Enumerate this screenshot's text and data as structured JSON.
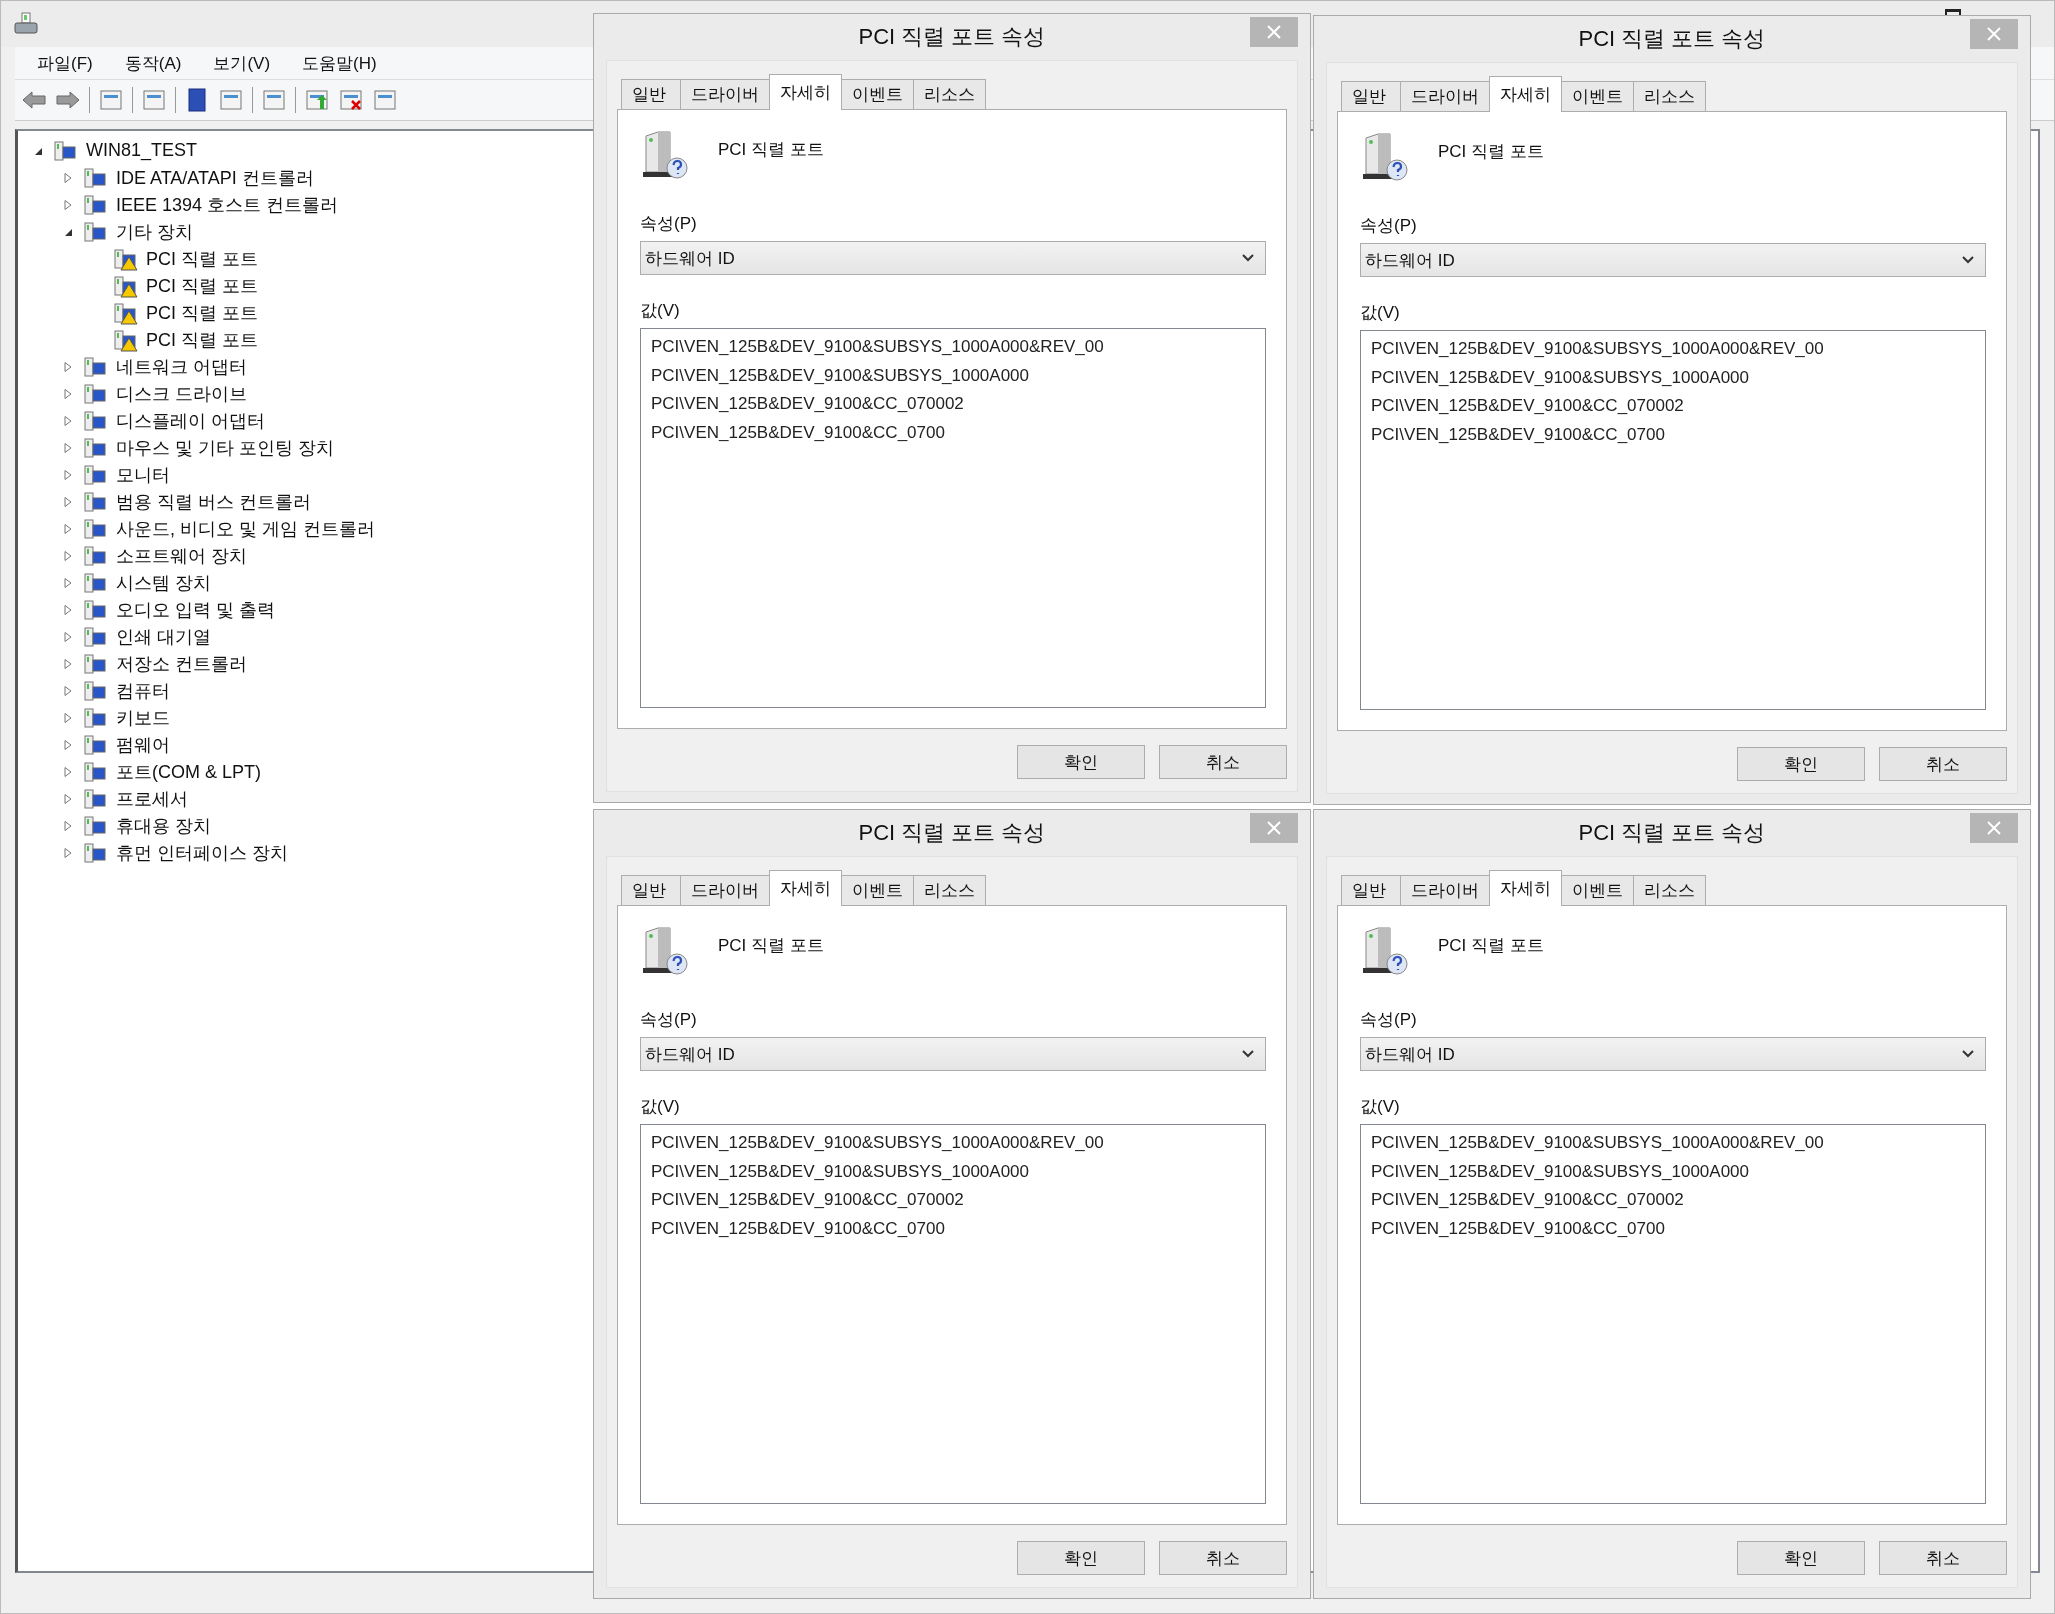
{
  "main_window": {
    "menu": [
      "파일(F)",
      "동작(A)",
      "보기(V)",
      "도움말(H)"
    ],
    "tree": {
      "label": "WIN81_TEST",
      "expanded": true,
      "children": [
        {
          "label": "IDE ATA/ATAPI 컨트롤러",
          "expanded": false
        },
        {
          "label": "IEEE 1394 호스트 컨트롤러",
          "expanded": false
        },
        {
          "label": "기타 장치",
          "expanded": true,
          "children": [
            {
              "label": "PCI 직렬 포트",
              "warning": true
            },
            {
              "label": "PCI 직렬 포트",
              "warning": true
            },
            {
              "label": "PCI 직렬 포트",
              "warning": true
            },
            {
              "label": "PCI 직렬 포트",
              "warning": true
            }
          ]
        },
        {
          "label": "네트워크 어댑터",
          "expanded": false
        },
        {
          "label": "디스크 드라이브",
          "expanded": false
        },
        {
          "label": "디스플레이 어댑터",
          "expanded": false
        },
        {
          "label": "마우스 및 기타 포인팅 장치",
          "expanded": false
        },
        {
          "label": "모니터",
          "expanded": false
        },
        {
          "label": "범용 직렬 버스 컨트롤러",
          "expanded": false
        },
        {
          "label": "사운드, 비디오 및 게임 컨트롤러",
          "expanded": false
        },
        {
          "label": "소프트웨어 장치",
          "expanded": false
        },
        {
          "label": "시스템 장치",
          "expanded": false
        },
        {
          "label": "오디오 입력 및 출력",
          "expanded": false
        },
        {
          "label": "인쇄 대기열",
          "expanded": false
        },
        {
          "label": "저장소 컨트롤러",
          "expanded": false
        },
        {
          "label": "컴퓨터",
          "expanded": false
        },
        {
          "label": "키보드",
          "expanded": false
        },
        {
          "label": "펌웨어",
          "expanded": false
        },
        {
          "label": "포트(COM & LPT)",
          "expanded": false
        },
        {
          "label": "프로세서",
          "expanded": false
        },
        {
          "label": "휴대용 장치",
          "expanded": false
        },
        {
          "label": "휴먼 인터페이스 장치",
          "expanded": false
        }
      ]
    }
  },
  "dialogs": [
    {
      "title": "PCI 직렬 포트 속성",
      "tabs": [
        {
          "label": "일반",
          "selected": false
        },
        {
          "label": "드라이버",
          "selected": false
        },
        {
          "label": "자세히",
          "selected": true
        },
        {
          "label": "이벤트",
          "selected": false
        },
        {
          "label": "리소스",
          "selected": false
        }
      ],
      "device_name": "PCI 직렬 포트",
      "property_label": "속성(P)",
      "property_value": "하드웨어 ID",
      "value_label": "값(V)",
      "values": [
        "PCI\\VEN_125B&DEV_9100&SUBSYS_1000A000&REV_00",
        "PCI\\VEN_125B&DEV_9100&SUBSYS_1000A000",
        "PCI\\VEN_125B&DEV_9100&CC_070002",
        "PCI\\VEN_125B&DEV_9100&CC_0700"
      ],
      "buttons": [
        "확인",
        "취소"
      ]
    },
    {
      "title": "PCI 직렬 포트 속성",
      "tabs": [
        {
          "label": "일반",
          "selected": false
        },
        {
          "label": "드라이버",
          "selected": false
        },
        {
          "label": "자세히",
          "selected": true
        },
        {
          "label": "이벤트",
          "selected": false
        },
        {
          "label": "리소스",
          "selected": false
        }
      ],
      "device_name": "PCI 직렬 포트",
      "property_label": "속성(P)",
      "property_value": "하드웨어 ID",
      "value_label": "값(V)",
      "values": [
        "PCI\\VEN_125B&DEV_9100&SUBSYS_1000A000&REV_00",
        "PCI\\VEN_125B&DEV_9100&SUBSYS_1000A000",
        "PCI\\VEN_125B&DEV_9100&CC_070002",
        "PCI\\VEN_125B&DEV_9100&CC_0700"
      ],
      "buttons": [
        "확인",
        "취소"
      ]
    },
    {
      "title": "PCI 직렬 포트 속성",
      "tabs": [
        {
          "label": "일반",
          "selected": false
        },
        {
          "label": "드라이버",
          "selected": false
        },
        {
          "label": "자세히",
          "selected": true
        },
        {
          "label": "이벤트",
          "selected": false
        },
        {
          "label": "리소스",
          "selected": false
        }
      ],
      "device_name": "PCI 직렬 포트",
      "property_label": "속성(P)",
      "property_value": "하드웨어 ID",
      "value_label": "값(V)",
      "values": [
        "PCI\\VEN_125B&DEV_9100&SUBSYS_1000A000&REV_00",
        "PCI\\VEN_125B&DEV_9100&SUBSYS_1000A000",
        "PCI\\VEN_125B&DEV_9100&CC_070002",
        "PCI\\VEN_125B&DEV_9100&CC_0700"
      ],
      "buttons": [
        "확인",
        "취소"
      ]
    },
    {
      "title": "PCI 직렬 포트 속성",
      "tabs": [
        {
          "label": "일반",
          "selected": false
        },
        {
          "label": "드라이버",
          "selected": false
        },
        {
          "label": "자세히",
          "selected": true
        },
        {
          "label": "이벤트",
          "selected": false
        },
        {
          "label": "리소스",
          "selected": false
        }
      ],
      "device_name": "PCI 직렬 포트",
      "property_label": "속성(P)",
      "property_value": "하드웨어 ID",
      "value_label": "값(V)",
      "values": [
        "PCI\\VEN_125B&DEV_9100&SUBSYS_1000A000&REV_00",
        "PCI\\VEN_125B&DEV_9100&SUBSYS_1000A000",
        "PCI\\VEN_125B&DEV_9100&CC_070002",
        "PCI\\VEN_125B&DEV_9100&CC_0700"
      ],
      "buttons": [
        "확인",
        "취소"
      ]
    }
  ]
}
